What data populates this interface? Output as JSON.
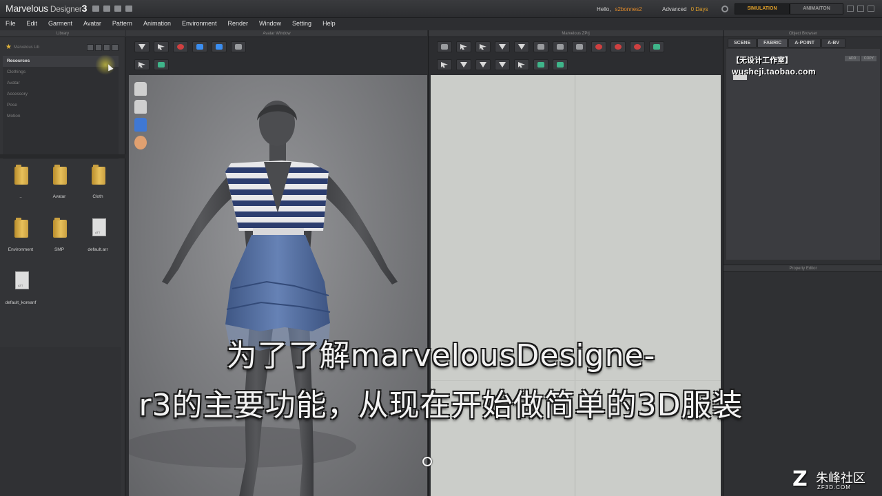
{
  "app": {
    "title_main": "Marvelous",
    "title_sub": " Designer",
    "title_version": "3",
    "greeting": "Hello,",
    "username": "s2bonnes2",
    "license_label": "Advanced",
    "license_days": "0 Days",
    "mode_simulation": "SIMULATION",
    "mode_animation": "ANIMAITON"
  },
  "menu": [
    "File",
    "Edit",
    "Garment",
    "Avatar",
    "Pattern",
    "Animation",
    "Environment",
    "Render",
    "Window",
    "Setting",
    "Help"
  ],
  "library": {
    "header": "Library",
    "path": "Marvelous Lib",
    "tree": [
      "Resources",
      "Clothings",
      "Avatar",
      "Accessory",
      "Pose",
      "Motion"
    ],
    "files": [
      {
        "label": "..",
        "type": "folder"
      },
      {
        "label": "Avatar",
        "type": "folder"
      },
      {
        "label": "Cloth",
        "type": "folder"
      },
      {
        "label": "Environment",
        "type": "folder"
      },
      {
        "label": "SMP",
        "type": "folder"
      },
      {
        "label": "default.arr",
        "type": "doc"
      },
      {
        "label": "default_koreanf",
        "type": "doc"
      }
    ]
  },
  "avatar_window": {
    "header": "Avatar Window"
  },
  "pattern_window": {
    "header": "Marvelous ZPrj"
  },
  "object_browser": {
    "header": "Object Browser",
    "tabs": [
      "SCENE",
      "FABRIC",
      "A-POINT",
      "A-BV"
    ],
    "watermark_cn": "【无设计工作室】",
    "watermark_url": "wusheji.taobao.com",
    "mini_buttons": [
      "ADD",
      "COPY"
    ]
  },
  "property_editor": {
    "header": "Property Editor"
  },
  "subtitles": {
    "line1": "为了了解marvelousDesigne-",
    "line2": "r3的主要功能，从现在开始做简单的3D服装"
  },
  "site_logo": {
    "mark": "Z",
    "name": "朱峰社区",
    "url": "ZF3D.COM"
  },
  "colors": {
    "accent_orange": "#e0a02a",
    "folder_yellow": "#e8c05a",
    "stripe_navy": "#2c3d6e",
    "skirt_blue": "#5673a8"
  }
}
